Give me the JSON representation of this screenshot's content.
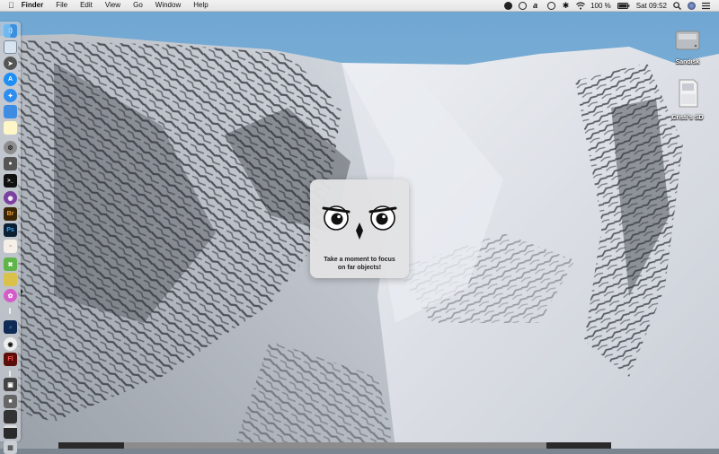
{
  "menubar": {
    "app_name": "Finder",
    "menus": [
      "File",
      "Edit",
      "View",
      "Go",
      "Window",
      "Help"
    ],
    "battery_percent": "100 %",
    "clock": "Sat 09:52",
    "status_icons": [
      "hands-icon",
      "blocked-icon",
      "script-a-icon",
      "time-machine-icon",
      "bluetooth-icon",
      "wifi-icon",
      "battery-icon",
      "search-icon",
      "siri-icon",
      "notification-center-icon"
    ]
  },
  "dock": {
    "apps": [
      "finder",
      "preview",
      "launchpad",
      "app-store",
      "safari",
      "mail",
      "notes",
      "settings",
      "terminal",
      "github",
      "bridge",
      "photoshop",
      "popcorn",
      "maps",
      "stickies",
      "flower",
      "tuner",
      "flash"
    ],
    "utilities": [
      "screenshot",
      "lock",
      "display",
      "video"
    ],
    "trash": "trash"
  },
  "desktop": {
    "drives": [
      {
        "label": "Sandisk",
        "icon": "drive-icon"
      },
      {
        "label": "Cristi's SD",
        "icon": "sd-card-icon"
      }
    ]
  },
  "popup": {
    "message_line1": "Take a moment to focus",
    "message_line2": "on far objects!",
    "icon": "owl-face-icon"
  },
  "colors": {
    "menubar": "#e8e8e8",
    "sky": "#7fb3d8",
    "snow": "#e6e9ee",
    "rock": "#3a3d42",
    "popup": "#e2e2e4"
  }
}
